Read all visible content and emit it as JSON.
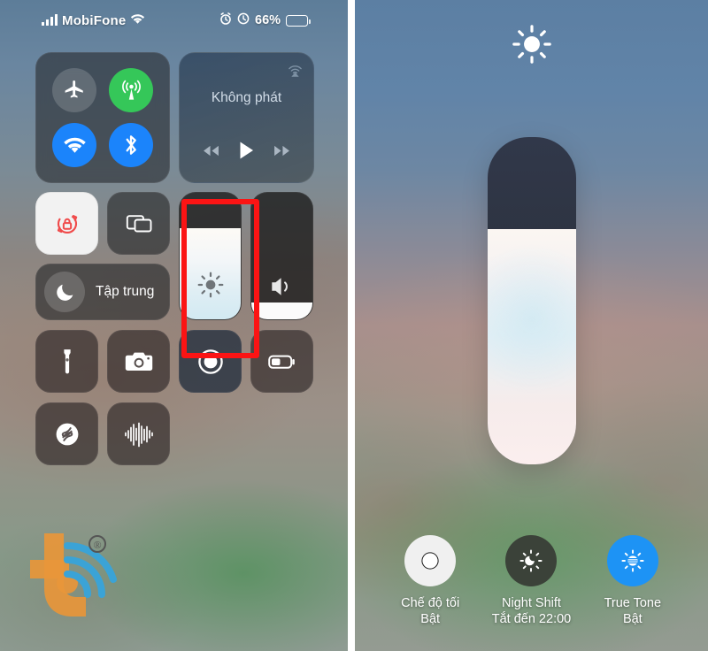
{
  "status_bar": {
    "signal_icon": "signal-bars-icon",
    "carrier": "MobiFone",
    "wifi_icon": "wifi-icon",
    "alarm_icon": "alarm-clock-icon",
    "orientation_lock_icon": "rotation-lock-status-icon",
    "battery_percent": "66%",
    "battery_level": 66,
    "battery_icon": "battery-icon"
  },
  "control_center": {
    "connectivity": {
      "airplane": {
        "name": "airplane-mode-toggle",
        "icon": "airplane-icon",
        "state": "off"
      },
      "cellular": {
        "name": "cellular-data-toggle",
        "icon": "cellular-antenna-icon",
        "state": "on",
        "color": "#35c759"
      },
      "wifi": {
        "name": "wifi-toggle",
        "icon": "wifi-icon",
        "state": "on",
        "color": "#1b84fb"
      },
      "bluetooth": {
        "name": "bluetooth-toggle",
        "icon": "bluetooth-icon",
        "state": "on",
        "color": "#1b84fb"
      }
    },
    "media": {
      "title": "Không phát",
      "airplay_icon": "airplay-icon",
      "prev_icon": "rewind-icon",
      "play_icon": "play-icon",
      "next_icon": "fast-forward-icon"
    },
    "rotation_lock": {
      "icon": "rotation-lock-icon",
      "state": "on",
      "color": "#f04a4a"
    },
    "screen_mirroring": {
      "icon": "screen-mirroring-icon",
      "state": "off"
    },
    "focus": {
      "label": "Tập trung",
      "icon": "moon-icon",
      "state": "off"
    },
    "brightness_slider": {
      "icon": "brightness-sun-icon",
      "value": 72,
      "highlighted": true,
      "highlight_color": "#fb1414"
    },
    "volume_slider": {
      "icon": "speaker-icon",
      "value": 13
    },
    "tiles": [
      {
        "name": "flashlight-tile",
        "icon": "flashlight-icon"
      },
      {
        "name": "camera-tile",
        "icon": "camera-icon"
      },
      {
        "name": "screen-record-tile",
        "icon": "record-icon"
      },
      {
        "name": "low-power-mode-tile",
        "icon": "battery-low-power-icon"
      },
      {
        "name": "shazam-tile",
        "icon": "shazam-icon"
      },
      {
        "name": "hearing-tile",
        "icon": "sound-waveform-icon"
      }
    ]
  },
  "watermark": {
    "letter": "t",
    "trademark": "®",
    "orange": "#e8963a",
    "blue": "#3ba3d6"
  },
  "brightness_detail": {
    "top_icon": "brightness-sun-icon",
    "slider": {
      "name": "expanded-brightness-slider",
      "value": 72
    },
    "options": [
      {
        "name": "dark-mode-option",
        "icon": "dark-mode-icon",
        "title": "Chế độ tối",
        "subtitle": "Bật",
        "circle": "white"
      },
      {
        "name": "night-shift-option",
        "icon": "night-shift-icon",
        "title": "Night Shift",
        "subtitle": "Tắt đến 22:00",
        "circle": "dark"
      },
      {
        "name": "true-tone-option",
        "icon": "true-tone-icon",
        "title": "True Tone",
        "subtitle": "Bật",
        "circle": "blue"
      }
    ]
  }
}
